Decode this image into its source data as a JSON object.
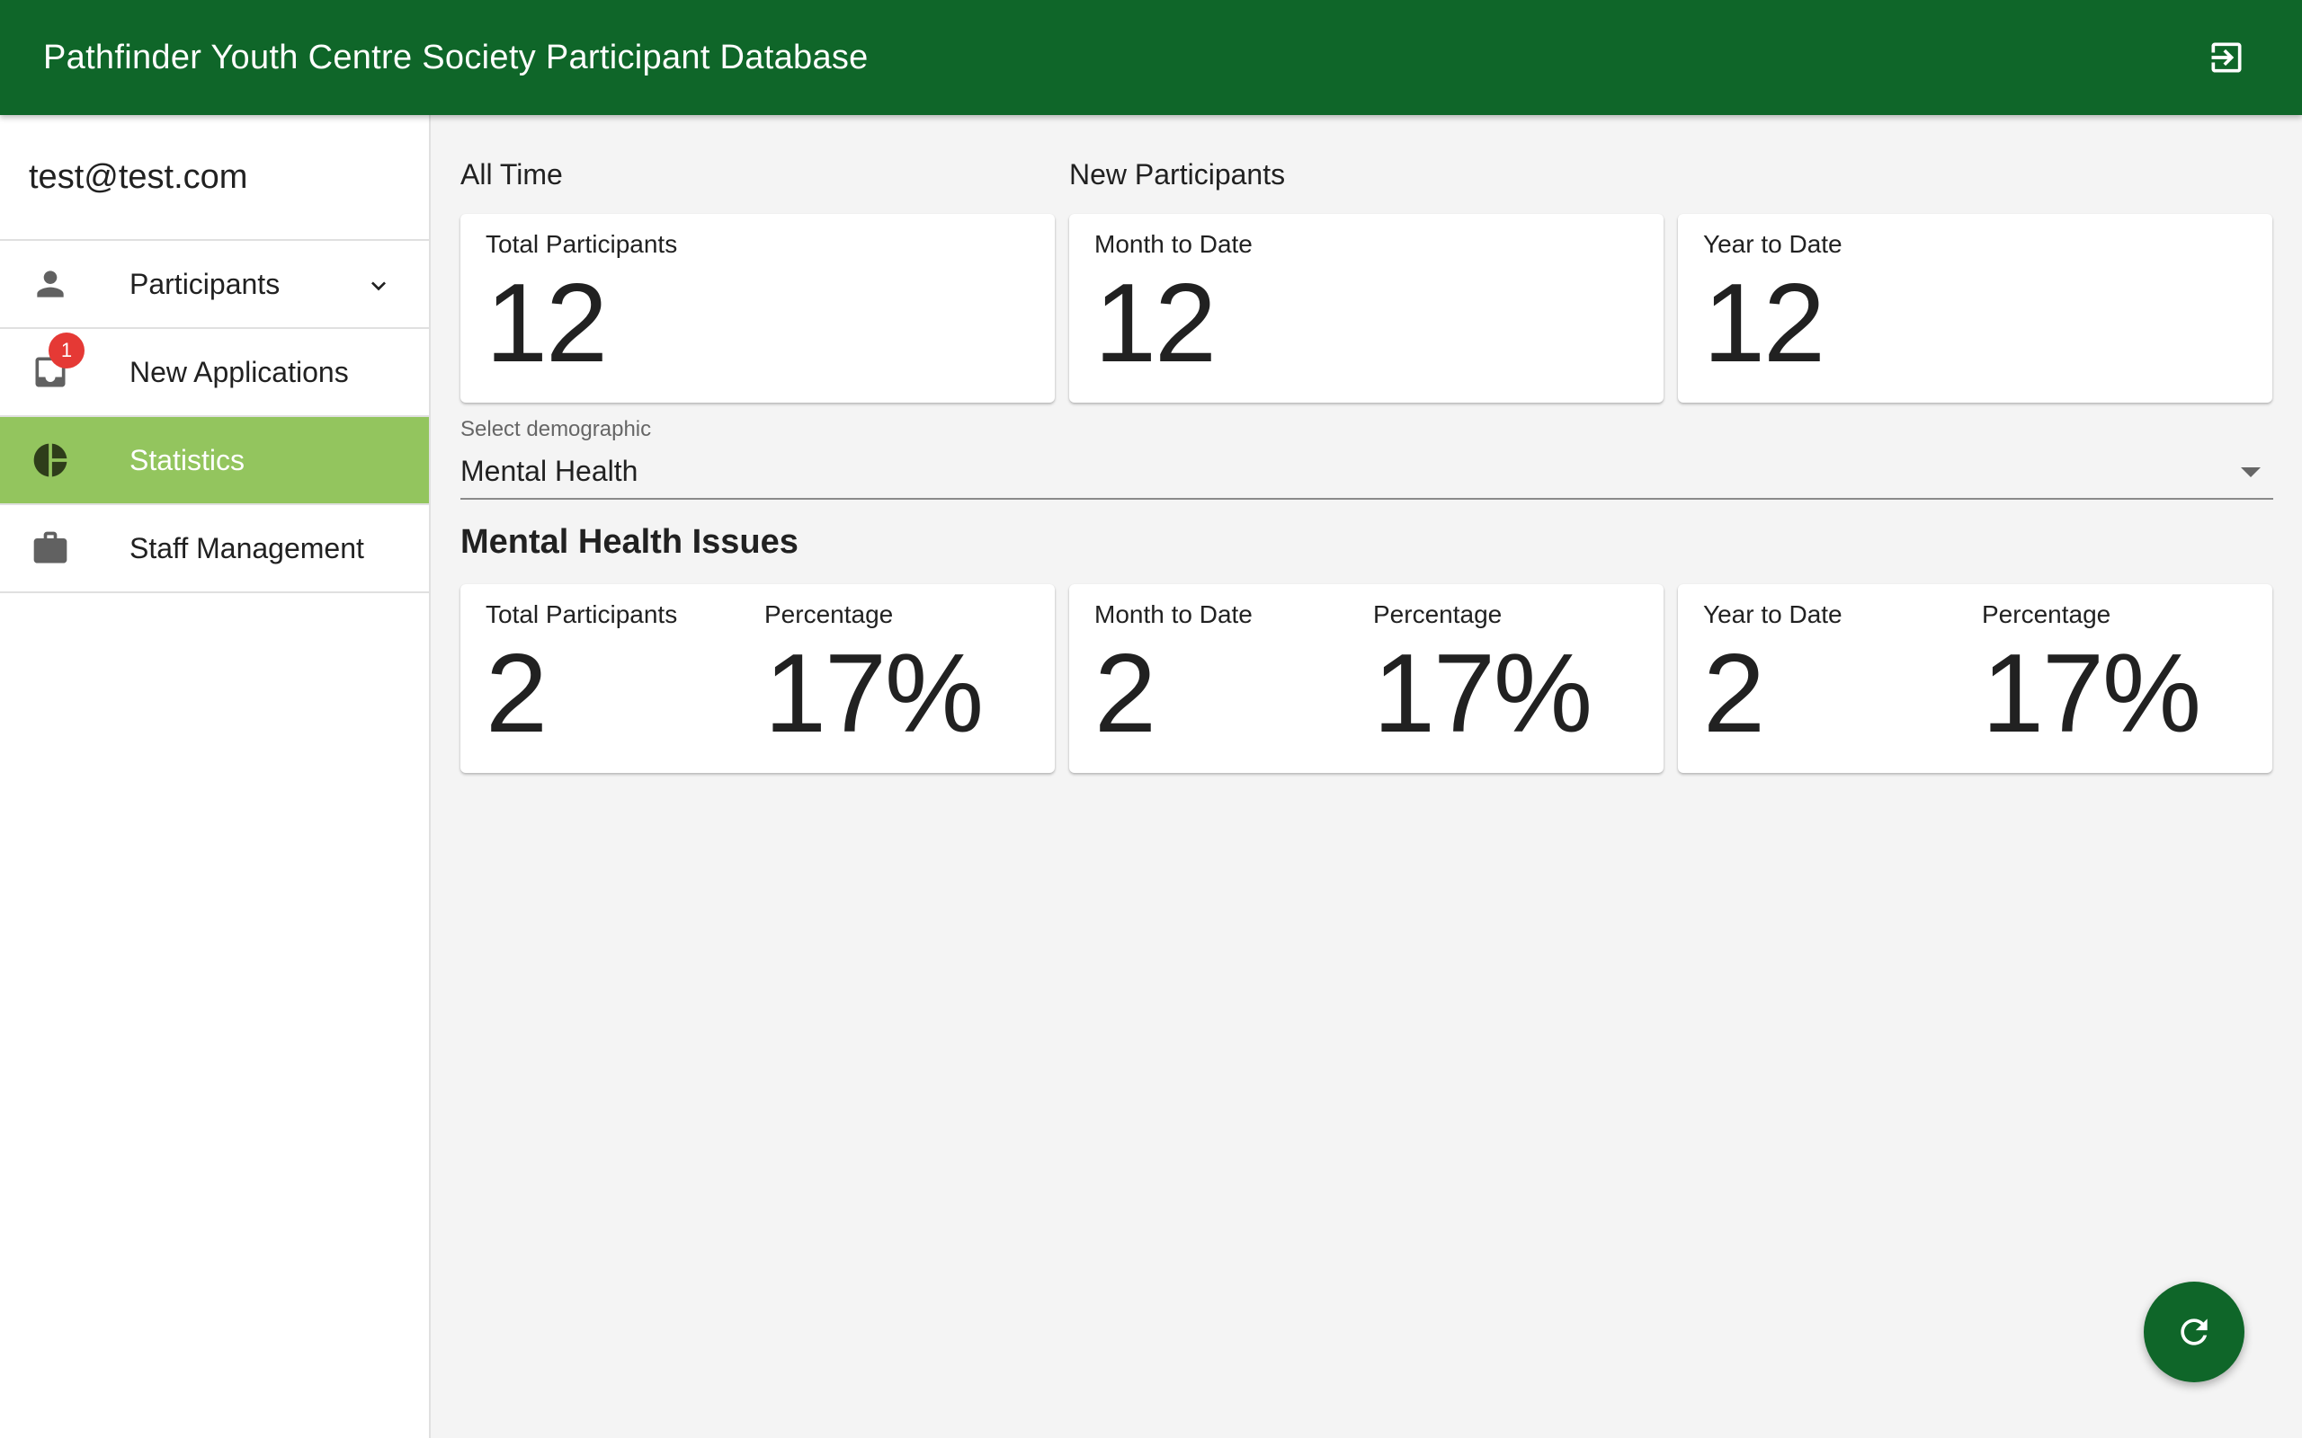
{
  "app": {
    "title": "Pathfinder Youth Centre Society Participant Database"
  },
  "header": {
    "logout_icon": "logout-icon"
  },
  "sidebar": {
    "user_email": "test@test.com",
    "items": [
      {
        "label": "Participants",
        "icon": "person-icon",
        "expandable": true
      },
      {
        "label": "New Applications",
        "icon": "inbox-icon",
        "badge": "1"
      },
      {
        "label": "Statistics",
        "icon": "pie-chart-icon",
        "active": true
      },
      {
        "label": "Staff Management",
        "icon": "briefcase-icon"
      }
    ]
  },
  "overview": {
    "all_time_label": "All Time",
    "new_participants_label": "New Participants",
    "cards": [
      {
        "label": "Total Participants",
        "value": "12"
      },
      {
        "label": "Month to Date",
        "value": "12"
      },
      {
        "label": "Year to Date",
        "value": "12"
      }
    ]
  },
  "demographic_select": {
    "label": "Select demographic",
    "value": "Mental Health"
  },
  "demographic_section": {
    "title": "Mental Health Issues",
    "cards": [
      {
        "label": "Total Participants",
        "value": "2",
        "pct_label": "Percentage",
        "pct_value": "17%"
      },
      {
        "label": "Month to Date",
        "value": "2",
        "pct_label": "Percentage",
        "pct_value": "17%"
      },
      {
        "label": "Year to Date",
        "value": "2",
        "pct_label": "Percentage",
        "pct_value": "17%"
      }
    ]
  },
  "fab": {
    "icon": "refresh-icon"
  },
  "colors": {
    "primary": "#0f6629",
    "active_nav": "#93c55e",
    "badge": "#e53935",
    "background": "#f4f4f4"
  }
}
